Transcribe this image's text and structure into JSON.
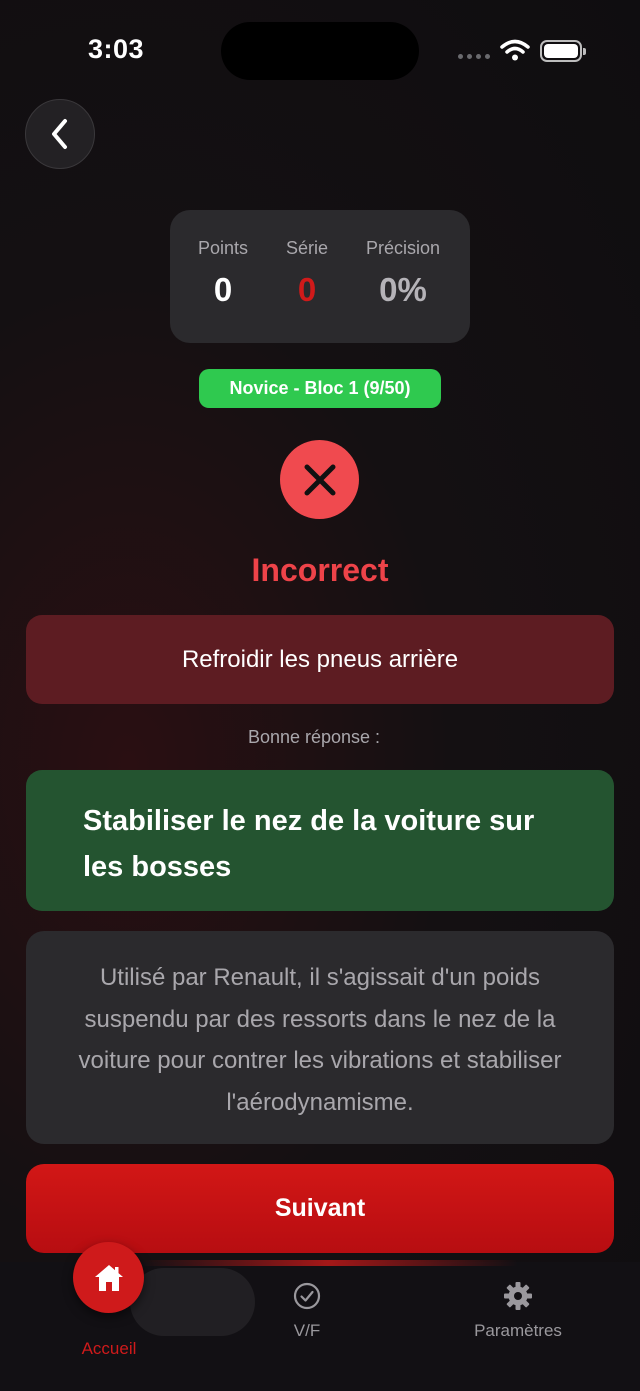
{
  "status_bar": {
    "time": "3:03"
  },
  "header": {
    "back_icon": "chevron-left-icon"
  },
  "stats": {
    "points": {
      "label": "Points",
      "value": "0"
    },
    "streak": {
      "label": "Série",
      "value": "0"
    },
    "precision": {
      "label": "Précision",
      "value": "0%"
    }
  },
  "level_badge": "Novice - Bloc 1 (9/50)",
  "result": {
    "icon": "x-mark-icon",
    "title": "Incorrect"
  },
  "user_answer": "Refroidir les pneus arrière",
  "correct_label": "Bonne réponse :",
  "correct_answer": "Stabiliser le nez de la voiture sur les bosses",
  "explanation": "Utilisé par Renault, il s'agissait d'un poids suspendu par des ressorts dans le nez de la voiture pour contrer les vibrations et stabiliser l'aérodynamisme.",
  "next_button": "Suivant",
  "tabbar": {
    "home": {
      "label": "Accueil",
      "icon": "home-icon"
    },
    "vf": {
      "label": "V/F",
      "icon": "check-circle-icon"
    },
    "settings": {
      "label": "Paramètres",
      "icon": "gear-icon"
    }
  },
  "colors": {
    "accent_red": "#cf1a1b",
    "incorrect": "#ee4349",
    "success_green": "#2fc94f",
    "correct_bg": "#245430",
    "wrong_bg": "#5d1c22"
  }
}
